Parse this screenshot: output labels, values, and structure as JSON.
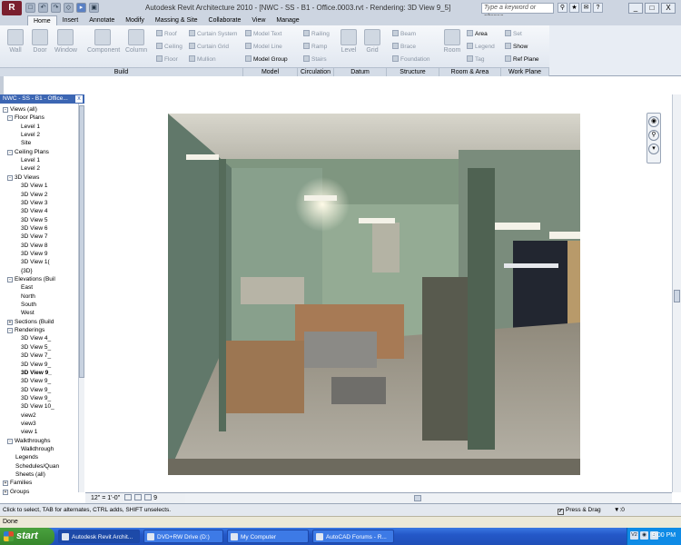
{
  "app": {
    "menu_button": "R",
    "title": "Autodesk Revit Architecture 2010 - [NWC - SS - B1 - Office.0003.rvt - Rendering: 3D View 9_5]",
    "search_placeholder": "Type a keyword or phrase",
    "quick_access": [
      "□",
      "↶",
      "↷",
      "◇",
      "▸",
      "▣"
    ],
    "window_controls": [
      "_",
      "□",
      "X"
    ]
  },
  "tabs": [
    "Home",
    "Insert",
    "Annotate",
    "Modify",
    "Massing & Site",
    "Collaborate",
    "View",
    "Manage"
  ],
  "ribbon": {
    "build": {
      "wall": "Wall",
      "door": "Door",
      "window": "Window",
      "component": "Component",
      "column": "Column",
      "roof": "Roof",
      "ceiling": "Ceiling",
      "floor": "Floor",
      "curtain_system": "Curtain System",
      "curtain_grid": "Curtain Grid",
      "mullion": "Mullion"
    },
    "model": {
      "text": "Model Text",
      "line": "Model Line",
      "group": "Model Group"
    },
    "circulation": {
      "railing": "Railing",
      "ramp": "Ramp",
      "stairs": "Stairs"
    },
    "datum": {
      "level": "Level",
      "grid": "Grid"
    },
    "structure": {
      "beam": "Beam",
      "brace": "Brace",
      "foundation": "Foundation"
    },
    "room_area": {
      "room": "Room",
      "area": "Area",
      "legend": "Legend",
      "tag": "Tag"
    },
    "work_plane": {
      "set": "Set",
      "show": "Show",
      "ref_plane": "Ref Plane"
    },
    "groups": [
      "Build",
      "Model",
      "Circulation",
      "Datum",
      "Structure",
      "Room & Area",
      "Work Plane"
    ]
  },
  "browser": {
    "header": "NWC - SS - B1 - Office...",
    "close": "x",
    "items": [
      {
        "label": "Views (all)",
        "toggle": "-"
      },
      {
        "label": "Floor Plans",
        "toggle": "-"
      },
      {
        "label": "Level 1"
      },
      {
        "label": "Level 2"
      },
      {
        "label": "Site"
      },
      {
        "label": "Ceiling Plans",
        "toggle": "-"
      },
      {
        "label": "Level 1"
      },
      {
        "label": "Level 2"
      },
      {
        "label": "3D Views",
        "toggle": "-"
      },
      {
        "label": "3D View 1"
      },
      {
        "label": "3D View 2"
      },
      {
        "label": "3D View 3"
      },
      {
        "label": "3D View 4"
      },
      {
        "label": "3D View 5"
      },
      {
        "label": "3D View 6"
      },
      {
        "label": "3D View 7"
      },
      {
        "label": "3D View 8"
      },
      {
        "label": "3D View 9"
      },
      {
        "label": "3D View 1("
      },
      {
        "label": "{3D}"
      },
      {
        "label": "Elevations (Buil",
        "toggle": "-"
      },
      {
        "label": "East"
      },
      {
        "label": "North"
      },
      {
        "label": "South"
      },
      {
        "label": "West"
      },
      {
        "label": "Sections (Build",
        "toggle": "+"
      },
      {
        "label": "Renderings",
        "toggle": "-"
      },
      {
        "label": "3D View 4_"
      },
      {
        "label": "3D View 5_"
      },
      {
        "label": "3D View 7_"
      },
      {
        "label": "3D View 9_"
      },
      {
        "label": "3D View 9_"
      },
      {
        "label": "3D View 9_"
      },
      {
        "label": "3D View 9_"
      },
      {
        "label": "3D View 9_"
      },
      {
        "label": "3D View 10_"
      },
      {
        "label": "view2"
      },
      {
        "label": "view3"
      },
      {
        "label": "view 1"
      },
      {
        "label": "Walkthroughs",
        "toggle": "-"
      },
      {
        "label": "Walkthrough"
      },
      {
        "label": "Legends"
      },
      {
        "label": "Schedules/Quan"
      },
      {
        "label": "Sheets (all)"
      },
      {
        "label": "Families",
        "toggle": "+"
      },
      {
        "label": "Groups",
        "toggle": "+"
      }
    ]
  },
  "view_control": {
    "scale": "12\" = 1'-0\"",
    "detail_number": "9"
  },
  "status": {
    "text": "Click to select, TAB for alternates, CTRL adds, SHIFT unselects.",
    "press_drag": "Press & Drag",
    "filter_count": ":0"
  },
  "bottom_status": "Done",
  "taskbar": {
    "start": "start",
    "items": [
      "Autodesk Revit Archit...",
      "DVD+RW Drive (D:)",
      "My Computer",
      "AutoCAD Forums - R..."
    ],
    "clock": "9:00 PM",
    "tray": [
      "V2",
      "◉",
      "♪"
    ]
  },
  "colors": {
    "title_bar": "#cdd5e1",
    "browser_header": "#3c66b3",
    "taskbar": "#2458c8",
    "start": "#37872c"
  }
}
